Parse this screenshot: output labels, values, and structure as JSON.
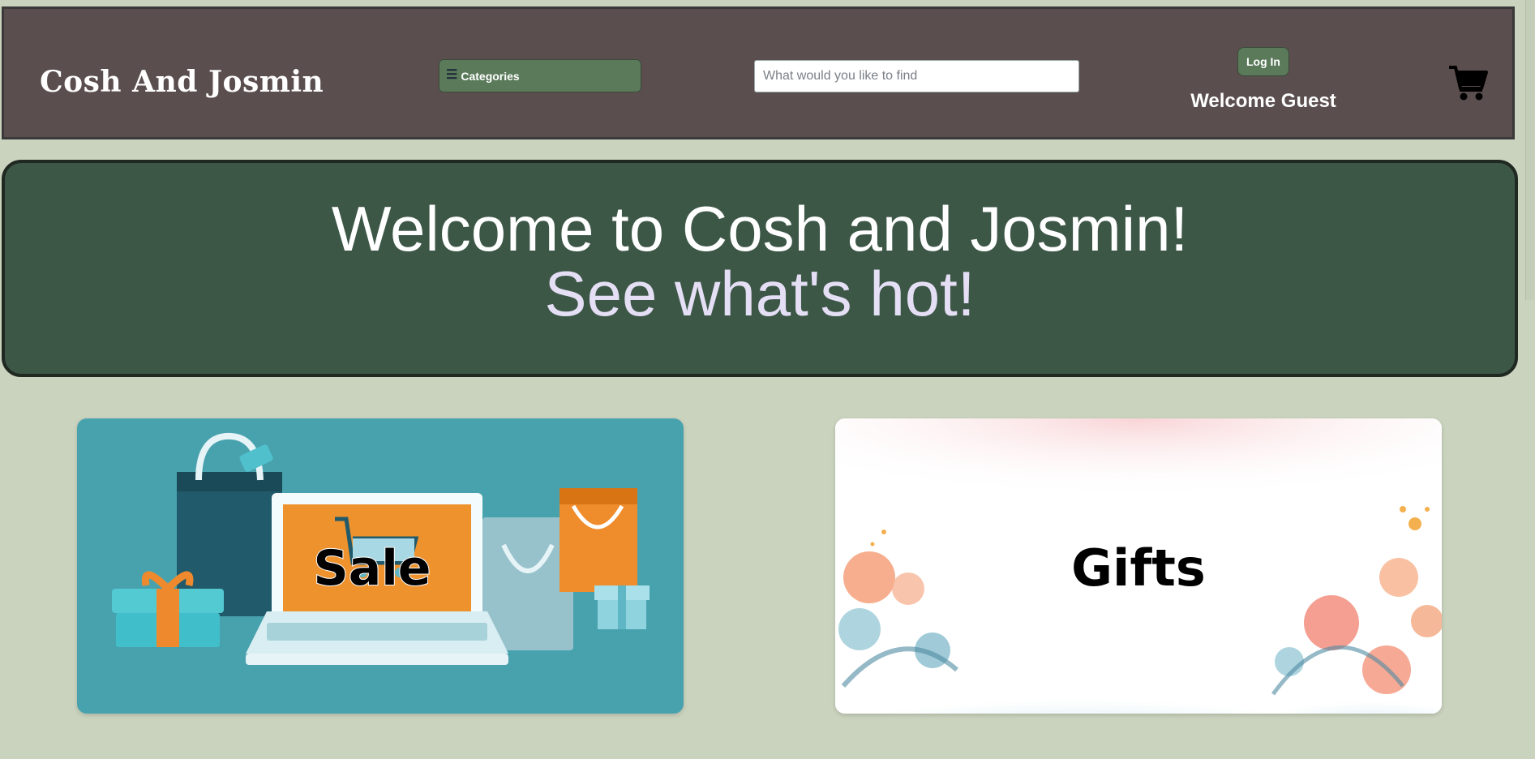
{
  "header": {
    "brand": "Cosh And Josmin",
    "categories_label": "Categories",
    "categories_icon": "hamburger-menu-icon",
    "search_placeholder": "What would you like to find",
    "login_label": "Log In",
    "welcome_text": "Welcome Guest",
    "cart_icon": "shopping-cart-icon"
  },
  "hero": {
    "line1": "Welcome to Cosh and Josmin!",
    "line2": "See what's hot!"
  },
  "cards": [
    {
      "label": "Sale",
      "image": "sale-illustration"
    },
    {
      "label": "Gifts",
      "image": "watercolor-flowers"
    }
  ],
  "colors": {
    "page_bg": "#cad3be",
    "header_bg": "#5b4e4e",
    "button_bg": "#5a7a5a",
    "hero_bg": "#3d5747",
    "hero_accent": "#e5dff6",
    "sale_bg": "#48a2ae"
  }
}
